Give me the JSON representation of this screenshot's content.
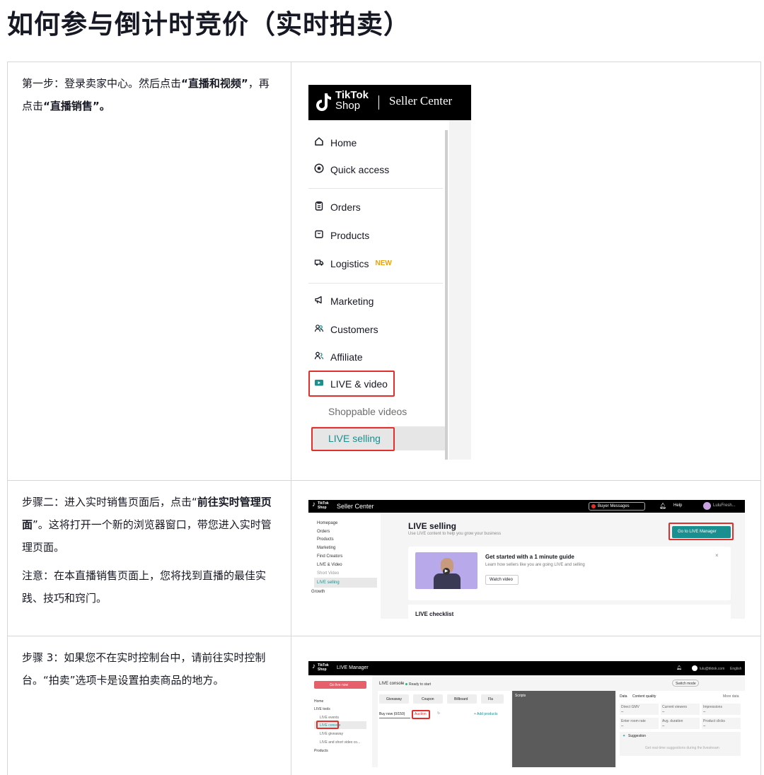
{
  "title": "如何参与倒计时竞价（实时拍卖）",
  "row1": {
    "parts": [
      {
        "t": "第一步：登录卖家中心。然后点击"
      },
      {
        "t": "“直播和视频”",
        "b": true
      },
      {
        "t": "，再点击"
      },
      {
        "t": "“直播销售”。",
        "b": true
      }
    ],
    "shot": {
      "logo_tiktok": "TikTok",
      "logo_shop": "Shop",
      "seller_center": "Seller Center",
      "nav": [
        {
          "label": "Home",
          "icon": "home-icon"
        },
        {
          "label": "Quick access",
          "icon": "star-circle-icon"
        },
        {
          "label": "Orders",
          "icon": "clipboard-icon"
        },
        {
          "label": "Products",
          "icon": "box-icon"
        },
        {
          "label": "Logistics",
          "icon": "truck-icon",
          "badge": "NEW"
        },
        {
          "label": "Marketing",
          "icon": "megaphone-icon"
        },
        {
          "label": "Customers",
          "icon": "users-icon"
        },
        {
          "label": "Affiliate",
          "icon": "people-icon"
        },
        {
          "label": "LIVE & video",
          "icon": "video-icon"
        },
        {
          "label": "Shoppable videos"
        },
        {
          "label": "LIVE selling"
        }
      ]
    }
  },
  "row2": {
    "p1": [
      {
        "t": "步骤二：进入实时销售页面后，点击“"
      },
      {
        "t": "前往实时管理页面",
        "b": true
      },
      {
        "t": "”。这将打开一个新的浏览器窗口，带您进入实时管理页面。"
      }
    ],
    "p2": "注意：在本直播销售页面上，您将找到直播的最佳实践、技巧和窍门。",
    "shot": {
      "brand": "Seller Center",
      "buyer_messages": "Buyer Messages",
      "help": "Help",
      "account": "LuluFresh...",
      "sidebar": [
        "Homepage",
        "Orders",
        "Products",
        "Marketing",
        "Find Creators",
        "LIVE & Video",
        "Short Video",
        "LIVE selling",
        "Growth"
      ],
      "heading": "LIVE selling",
      "sub": "Use LIVE content to help you grow your business",
      "go_button": "Go to LIVE Manager",
      "guide_title": "Get started with a 1 minute guide",
      "guide_sub": "Learn how sellers like you are going LIVE and selling",
      "watch": "Watch video",
      "checklist": "LIVE checklist",
      "colors": {
        "accent": "#1a8f8f",
        "purple": "#b8a9ea"
      }
    }
  },
  "row3": {
    "p1": "步骤 3：如果您不在实时控制台中，请前往实时控制台。“拍卖”选项卡是设置拍卖商品的地方。",
    "shot": {
      "brand": "LIVE Manager",
      "go_live": "Go live now",
      "console": "LIVE console",
      "ready": "Ready to start",
      "tools": [
        "Giveaway",
        "Coupon",
        "Billboard",
        "Fla"
      ],
      "tab_buy": "Buy now (0/150)",
      "tab_auction": "Auction",
      "add_products": "+ Add products",
      "scripts": "Scripts",
      "sidebar": [
        "Home",
        "LIVE tools",
        "LIVE events",
        "LIVE console",
        "LIVE giveaway",
        "LIVE and short video co...",
        "Products"
      ],
      "switch_mode": "Switch mode",
      "data_tab": "Data",
      "cq_tab": "Content quality",
      "more_data": "More data",
      "metrics": [
        {
          "k": "Direct GMV",
          "v": "--"
        },
        {
          "k": "Current viewers",
          "v": "--"
        },
        {
          "k": "Impressions",
          "v": "--"
        },
        {
          "k": "Enter room rate",
          "v": "--"
        },
        {
          "k": "Avg. duration",
          "v": "--"
        },
        {
          "k": "Product clicks",
          "v": "--"
        }
      ],
      "suggestion": "Suggestion",
      "suggestion_text": "Get real-time suggestions during the livestream",
      "account": "lulu@tiktok.com",
      "lang": "English"
    }
  }
}
